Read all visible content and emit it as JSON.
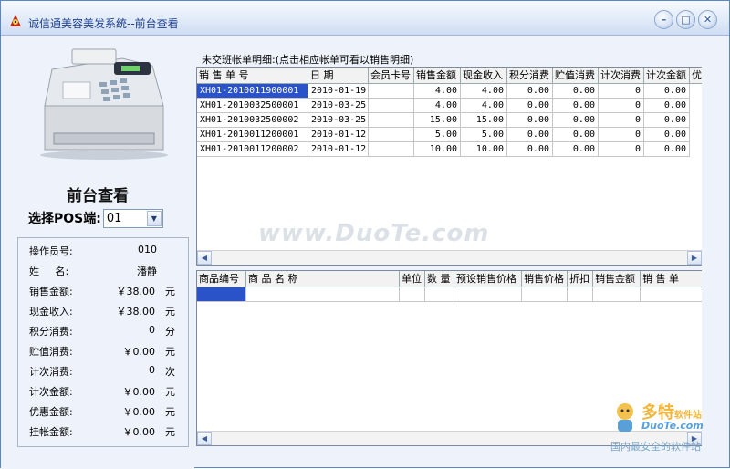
{
  "window": {
    "title": "诚信通美容美发系统--前台查看",
    "colors": {
      "titlebar": "#dfe9f8",
      "selection": "#2a52c9",
      "panel": "#eef3fb"
    }
  },
  "left": {
    "heading": "前台查看",
    "pos_label": "选择POS端:",
    "pos_value": "01",
    "info": [
      {
        "label": "操作员号:",
        "value": "010",
        "unit": ""
      },
      {
        "label": "姓     名:",
        "value": "潘静",
        "unit": ""
      },
      {
        "label": "销售金额:",
        "value": "￥38.00",
        "unit": "元"
      },
      {
        "label": "现金收入:",
        "value": "￥38.00",
        "unit": "元"
      },
      {
        "label": "积分消费:",
        "value": "0",
        "unit": "分"
      },
      {
        "label": "贮值消费:",
        "value": "￥0.00",
        "unit": "元"
      },
      {
        "label": "计次消费:",
        "value": "0",
        "unit": "次"
      },
      {
        "label": "计次金额:",
        "value": "￥0.00",
        "unit": "元"
      },
      {
        "label": "优惠金额:",
        "value": "￥0.00",
        "unit": "元"
      },
      {
        "label": "挂帐金额:",
        "value": "￥0.00",
        "unit": "元"
      }
    ]
  },
  "top_grid": {
    "caption": "未交班帐单明细:(点击相应帐单可看以销售明细)",
    "headers": [
      "销    售    单    号",
      "日    期",
      "会员卡号",
      "销售金额",
      "现金收入",
      "积分消费",
      "贮值消费",
      "计次消费",
      "计次金额",
      "优"
    ],
    "rows": [
      [
        "XH01-2010011900001",
        "2010-01-19",
        "",
        "4.00",
        "4.00",
        "0.00",
        "0.00",
        "0",
        "0.00"
      ],
      [
        "XH01-2010032500001",
        "2010-03-25",
        "",
        "4.00",
        "4.00",
        "0.00",
        "0.00",
        "0",
        "0.00"
      ],
      [
        "XH01-2010032500002",
        "2010-03-25",
        "",
        "15.00",
        "15.00",
        "0.00",
        "0.00",
        "0",
        "0.00"
      ],
      [
        "XH01-2010011200001",
        "2010-01-12",
        "",
        "5.00",
        "5.00",
        "0.00",
        "0.00",
        "0",
        "0.00"
      ],
      [
        "XH01-2010011200002",
        "2010-01-12",
        "",
        "10.00",
        "10.00",
        "0.00",
        "0.00",
        "0",
        "0.00"
      ]
    ]
  },
  "bottom_grid": {
    "headers": [
      "商品编号",
      "商    品    名    称",
      "单位",
      "数 量",
      "预设销售价格",
      "销售价格",
      "折扣",
      "销售金额",
      "销    售    单"
    ]
  },
  "watermark": {
    "main": "www.DuoTe.com",
    "brand": "多特",
    "brand_small": "软件站",
    "site": "DuoTe.com",
    "slogan": "国内最安全的软件站"
  }
}
